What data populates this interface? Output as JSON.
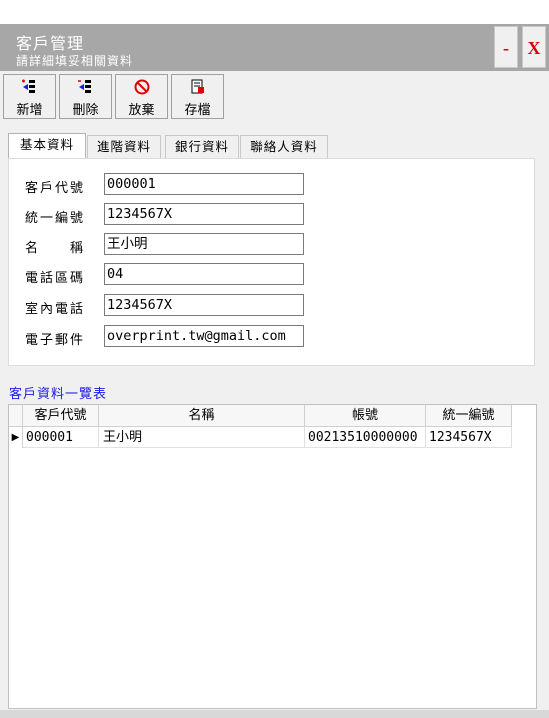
{
  "window": {
    "title": "客戶管理",
    "subtitle": "請詳細填妥相關資料",
    "minimize_label": "-",
    "close_label": "X"
  },
  "toolbar": {
    "buttons": [
      {
        "label": "新增",
        "icon": "add-row-icon"
      },
      {
        "label": "刪除",
        "icon": "delete-row-icon"
      },
      {
        "label": "放棄",
        "icon": "cancel-icon"
      },
      {
        "label": "存檔",
        "icon": "save-icon"
      }
    ]
  },
  "tabs": [
    {
      "label": "基本資料",
      "active": true
    },
    {
      "label": "進階資料",
      "active": false
    },
    {
      "label": "銀行資料",
      "active": false
    },
    {
      "label": "聯絡人資料",
      "active": false
    }
  ],
  "form": {
    "fields": [
      {
        "label": "客戶代號",
        "value": "000001"
      },
      {
        "label": "統一編號",
        "value": "1234567X"
      },
      {
        "label": "名　　稱",
        "value": "王小明"
      },
      {
        "label": "電話區碼",
        "value": "04"
      },
      {
        "label": "室內電話",
        "value": "1234567X"
      },
      {
        "label": "電子郵件",
        "value": "overprint.tw@gmail.com"
      }
    ]
  },
  "list": {
    "title": "客戶資料一覽表",
    "columns": [
      "客戶代號",
      "名稱",
      "帳號",
      "統一編號"
    ],
    "rows": [
      [
        "000001",
        "王小明",
        "00213510000000",
        "1234567X"
      ]
    ],
    "row_indicator": "▶"
  },
  "colors": {
    "titlebar": "#a7a7a7",
    "close_red": "#e00000",
    "list_title_blue": "#1a1ae6"
  }
}
